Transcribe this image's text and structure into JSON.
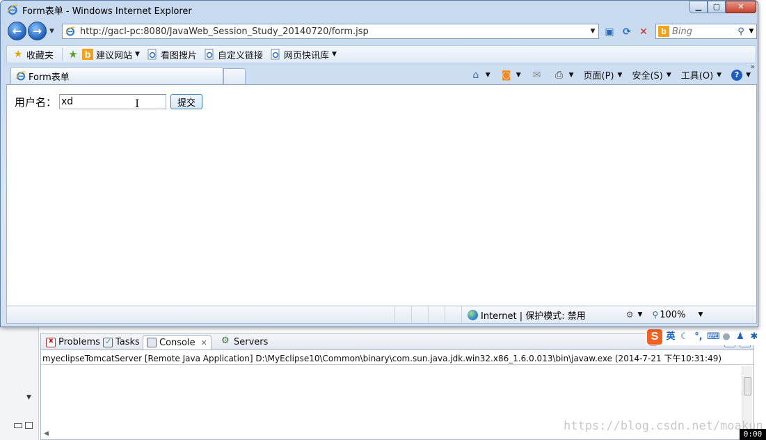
{
  "ie": {
    "window_title": "Form表单 - Windows Internet Explorer",
    "address_url": "http://gacl-pc:8080/JavaWeb_Session_Study_20140720/form.jsp",
    "search_placeholder": "Bing",
    "favorites_bar": {
      "favorites_label": "收藏夹",
      "items": [
        "建议网站",
        "看图搜片",
        "自定义链接",
        "网页快讯库"
      ]
    },
    "tab_title": "Form表单",
    "command_bar": {
      "page_label": "页面(P)",
      "safety_label": "安全(S)",
      "tools_label": "工具(O)"
    },
    "form": {
      "username_label": "用户名：",
      "username_value": "xd",
      "submit_label": "提交"
    },
    "status_bar": {
      "zone_text": "Internet | 保护模式: 禁用",
      "zoom_text": "100%"
    }
  },
  "eclipse": {
    "tabs": [
      {
        "label": "Problems",
        "icon": "problems-icon"
      },
      {
        "label": "Tasks",
        "icon": "tasks-icon"
      },
      {
        "label": "Console",
        "icon": "console-icon",
        "active": true
      },
      {
        "label": "Servers",
        "icon": "servers-icon"
      }
    ],
    "console_header": "myeclipseTomcatServer [Remote Java Application] D:\\MyEclipse10\\Common\\binary\\com.sun.java.jdk.win32.x86_1.6.0.013\\bin\\javaw.exe (2014-7-21 下午10:31:49)"
  },
  "ime": {
    "logo": "S",
    "mode": "英"
  },
  "watermark": "https://blog.csdn.net/moakun",
  "clock": "0:00"
}
